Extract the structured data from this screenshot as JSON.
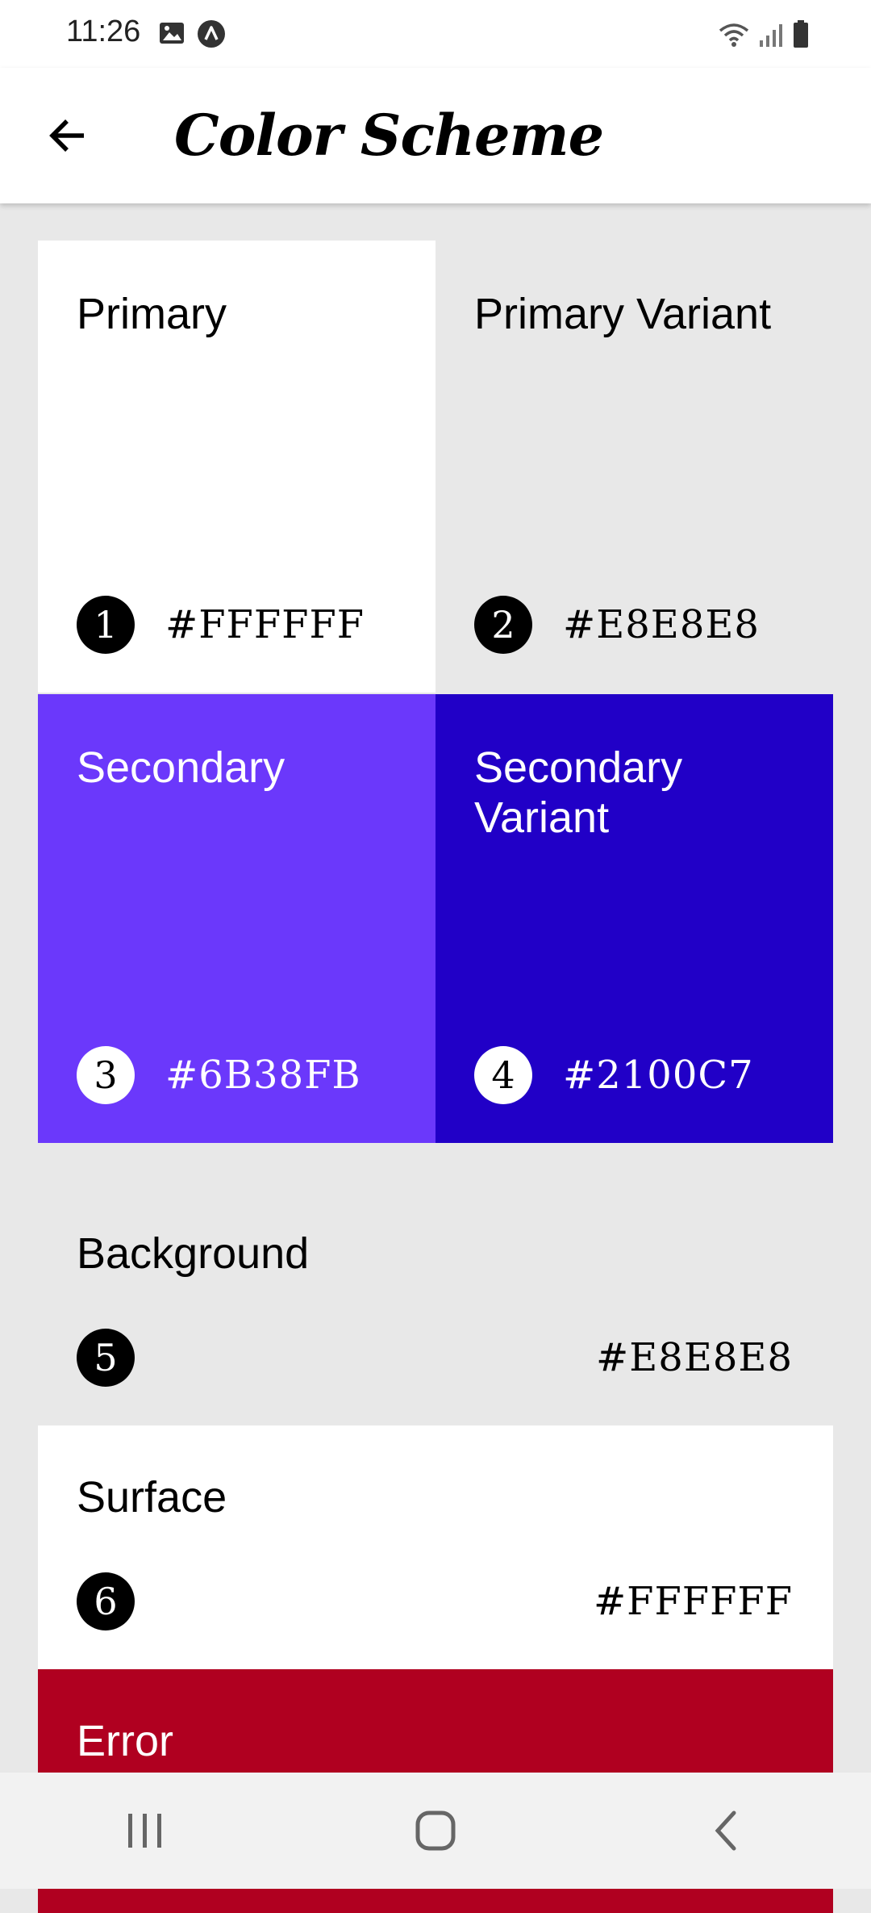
{
  "status_bar": {
    "time": "11:26",
    "left_icons": [
      "image-icon",
      "app-icon"
    ],
    "right_icons": [
      "wifi-icon",
      "signal-icon",
      "battery-icon"
    ]
  },
  "app_bar": {
    "title": "Color Scheme",
    "back_icon": "arrow-left-icon"
  },
  "colors": {
    "primary": {
      "label": "Primary",
      "number": "1",
      "hex": "#FFFFFF"
    },
    "primary_variant": {
      "label": "Primary Variant",
      "number": "2",
      "hex": "#E8E8E8"
    },
    "secondary": {
      "label": "Secondary",
      "number": "3",
      "hex": "#6B38FB"
    },
    "secondary_variant": {
      "label": "Secondary Variant",
      "number": "4",
      "hex": "#2100C7"
    },
    "background": {
      "label": "Background",
      "number": "5",
      "hex": "#E8E8E8"
    },
    "surface": {
      "label": "Surface",
      "number": "6",
      "hex": "#FFFFFF"
    },
    "error": {
      "label": "Error",
      "swatch": "#B00020"
    }
  },
  "nav_bar": {
    "icons": [
      "recent-apps-icon",
      "home-icon",
      "back-nav-icon"
    ]
  }
}
